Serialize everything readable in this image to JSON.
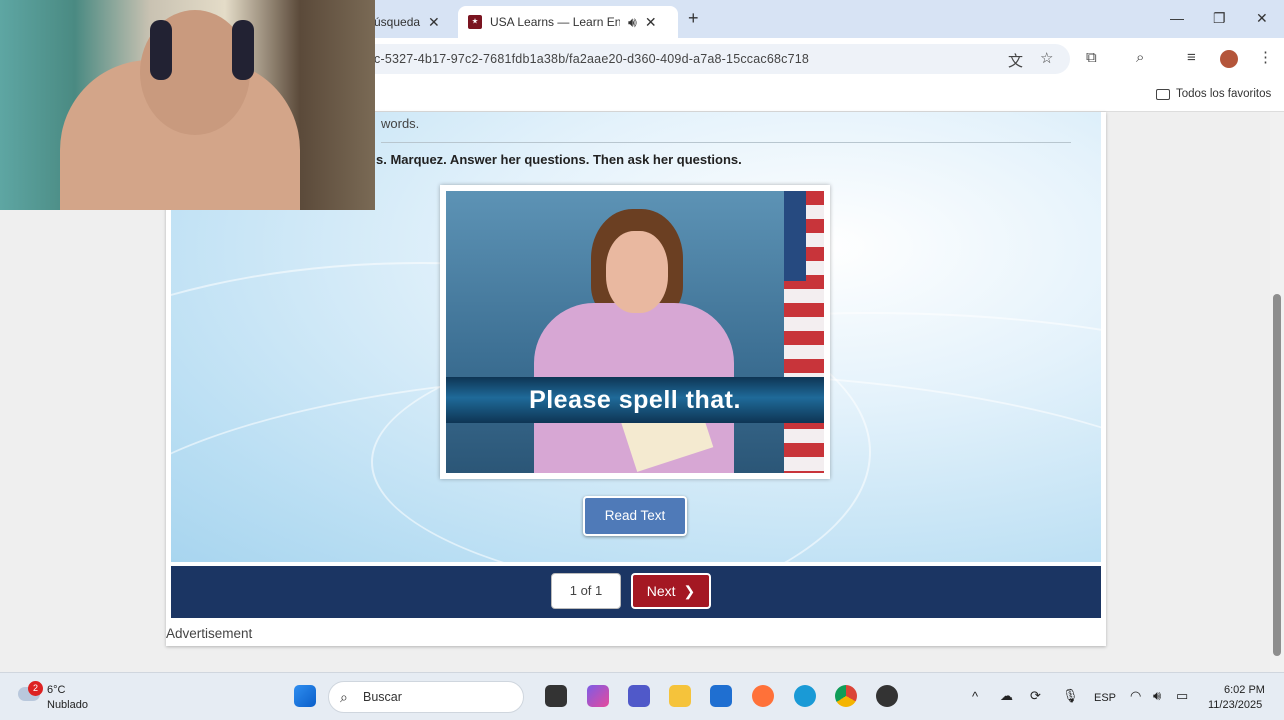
{
  "browser": {
    "tab_inactive": "úsqueda",
    "tab_active": "USA Learns — Learn English",
    "url": "c-5327-4b17-97c2-7681fdb1a38b/fa2aae20-d360-409d-a7a8-15ccac68c718",
    "bookmark_folder": "Todos los favoritos"
  },
  "lesson": {
    "words_label": "words.",
    "instruction": "s. Marquez. Answer her questions. Then ask her questions.",
    "video_caption": "Please spell that.",
    "read_text_button": "Read Text",
    "pager": "1 of 1",
    "next_button": "Next",
    "advertisement": "Advertisement"
  },
  "taskbar": {
    "weather_temp": "6°C",
    "weather_desc": "Nublado",
    "weather_badge": "2",
    "search_label": "Buscar",
    "lang": "ESP",
    "time": "6:02 PM",
    "date": "11/23/2025"
  }
}
